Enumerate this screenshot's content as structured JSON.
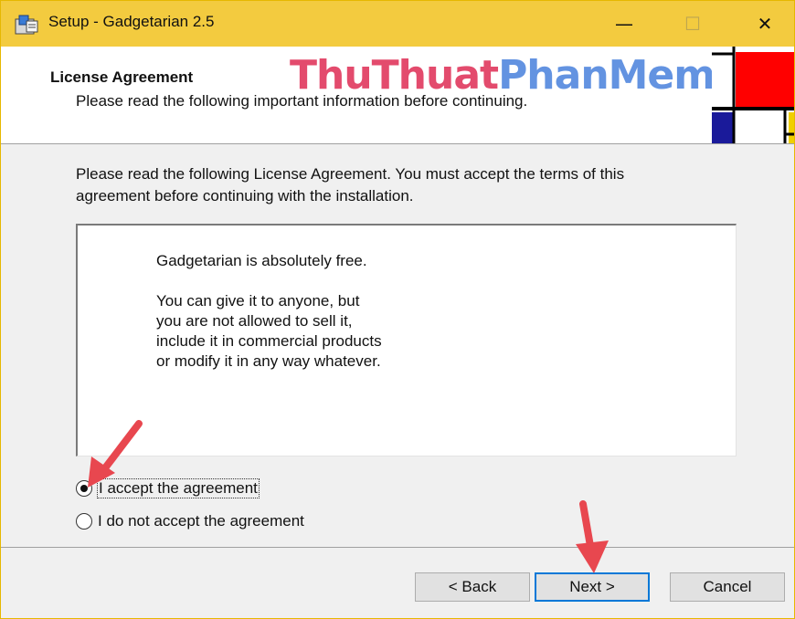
{
  "window": {
    "title": "Setup - Gadgetarian 2.5"
  },
  "titlebar": {
    "minimize_glyph": "—",
    "maximize_glyph": "☐",
    "close_glyph": "✕"
  },
  "header": {
    "title": "License Agreement",
    "subtitle": "Please read the following important information before continuing.",
    "watermark_part1": "ThuThuat",
    "watermark_part2": "PhanMem.vn"
  },
  "intro": {
    "line1": "Please read the following License Agreement. You must accept the terms of this",
    "line2": "agreement before continuing with the installation."
  },
  "license": {
    "line1": "Gadgetarian is absolutely free.",
    "para2": [
      "You can give it to anyone, but",
      "you are not allowed to sell it,",
      "include it in commercial products",
      "or modify it in any way whatever."
    ]
  },
  "options": [
    {
      "label": "I accept the agreement",
      "checked": true
    },
    {
      "label": "I do not accept the agreement",
      "checked": false
    }
  ],
  "buttons": {
    "back": "< Back",
    "next": "Next >",
    "cancel": "Cancel"
  },
  "colors": {
    "titlebar": "#f3cb3f",
    "focus_border": "#0078d7",
    "annotation_arrow": "#e8474f"
  },
  "icons": {
    "app": "setup-icon",
    "minimize": "minimize-icon",
    "maximize": "maximize-icon",
    "close": "close-icon"
  }
}
